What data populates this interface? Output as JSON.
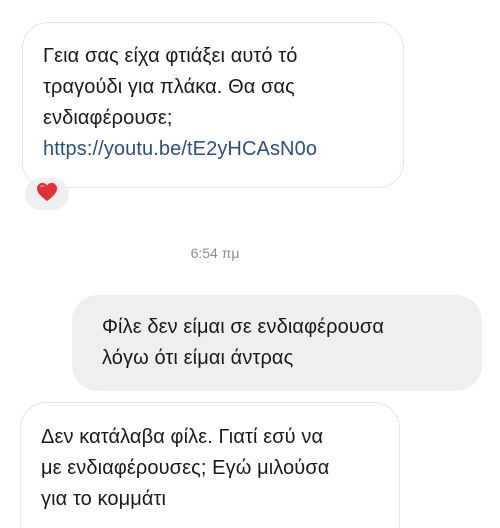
{
  "conversation": {
    "messages": [
      {
        "direction": "incoming",
        "lines": [
          "Γεια σας είχα φτιάξει αυτό τό",
          "τραγούδι για πλάκα. Θα σας",
          "ενδιαφέρουσε;",
          "https://youtu.be/tE2yHCAsN0o"
        ],
        "reaction": "heart"
      },
      {
        "direction": "outgoing",
        "lines": [
          "Φίλε δεν είμαι σε ενδιαφέρουσα",
          "λόγω ότι είμαι άντρας"
        ]
      },
      {
        "direction": "incoming",
        "lines": [
          "Δεν κατάλαβα φίλε. Γιατί εσύ να",
          "με ενδιαφέρουσες; Εγώ μιλούσα",
          "για το κομμάτι"
        ]
      }
    ],
    "timestamp": "6:54 πμ"
  },
  "colors": {
    "link": "#2c4f85",
    "heart": "#e0303a",
    "outgoing_bubble": "#efefef",
    "incoming_border": "#e6e6e6",
    "timestamp": "#8e8e8e"
  },
  "icons": {
    "reaction": "heart-icon"
  }
}
